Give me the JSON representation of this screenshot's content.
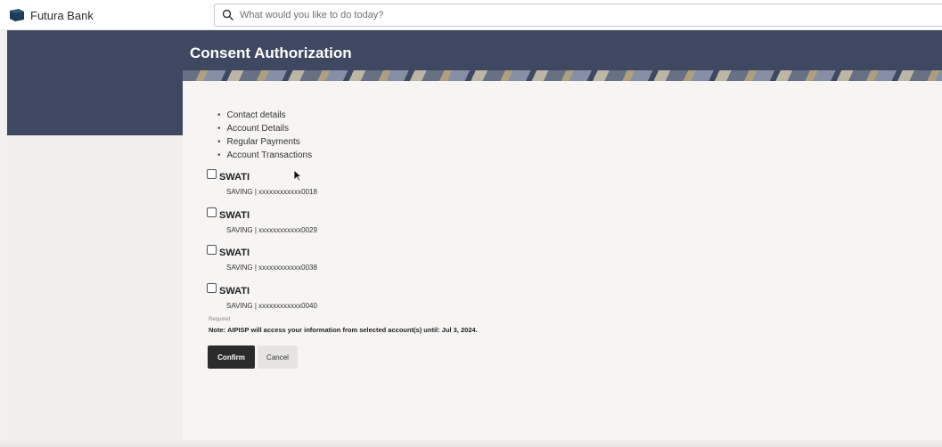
{
  "header": {
    "brand_name": "Futura Bank",
    "search_placeholder": "What would you like to do today?"
  },
  "page": {
    "title": "Consent Authorization"
  },
  "permissions": [
    "Contact details",
    "Account Details",
    "Regular Payments",
    "Account Transactions"
  ],
  "accounts": [
    {
      "name": "SWATI",
      "detail": "SAVING | xxxxxxxxxxxx0018",
      "checked": false
    },
    {
      "name": "SWATI",
      "detail": "SAVING | xxxxxxxxxxxx0029",
      "checked": false
    },
    {
      "name": "SWATI",
      "detail": "SAVING | xxxxxxxxxxxx0038",
      "checked": false
    },
    {
      "name": "SWATI",
      "detail": "SAVING | xxxxxxxxxxxx0040",
      "checked": false
    }
  ],
  "form": {
    "required_label": "Required",
    "note": "Note: AIPISP will access your information from selected account(s) until: Jul 3, 2024.",
    "confirm_label": "Confirm",
    "cancel_label": "Cancel"
  },
  "colors": {
    "header_band": "#3f4861",
    "primary_button": "#2b2b2b",
    "brand_logo": "#1f3b57"
  },
  "icons": {
    "brand": "bank-logo-icon",
    "search": "search-icon",
    "cursor": "mouse-pointer-icon"
  }
}
